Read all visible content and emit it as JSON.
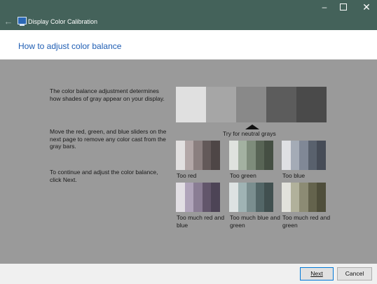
{
  "window": {
    "title": "Display Color Calibration",
    "controls": {
      "minimize": "–",
      "maximize": "",
      "close": "✕"
    }
  },
  "header": {
    "heading": "How to adjust color balance"
  },
  "main": {
    "paragraphs": [
      "The color balance adjustment determines how shades of gray appear on your display.",
      "Move the red, green, and blue sliders on the next page to remove any color cast from the gray bars.",
      "To continue and adjust the color balance, click Next."
    ],
    "neutral_label": "Try for neutral grays",
    "neutral_colors": [
      "#e0e0e0",
      "#a6a6a6",
      "#898989",
      "#5c5c5c",
      "#4a4a4a"
    ],
    "swatches": [
      {
        "label": "Too red",
        "colors": [
          "#e2e0e0",
          "#b3a7a7",
          "#8b7f7f",
          "#635959",
          "#4e4646"
        ]
      },
      {
        "label": "Too green",
        "colors": [
          "#dfe2de",
          "#a3b1a1",
          "#7e8c7b",
          "#586455",
          "#454f43"
        ]
      },
      {
        "label": "Too blue",
        "colors": [
          "#dfe0e3",
          "#a4abb6",
          "#808896",
          "#59616d",
          "#464c57"
        ]
      },
      {
        "label": "Too much red and blue",
        "colors": [
          "#e2dfe4",
          "#b0a4ba",
          "#8a7d94",
          "#62566b",
          "#4d4456"
        ]
      },
      {
        "label": "Too much blue and green",
        "colors": [
          "#dde2e2",
          "#9fb3b4",
          "#7a8e8f",
          "#536667",
          "#415050"
        ]
      },
      {
        "label": "Too much red and green",
        "colors": [
          "#e2e2dc",
          "#b1b19b",
          "#8c8b74",
          "#64634d",
          "#4f4e3b"
        ]
      }
    ]
  },
  "footer": {
    "next_label": "Next",
    "cancel_label": "Cancel"
  }
}
